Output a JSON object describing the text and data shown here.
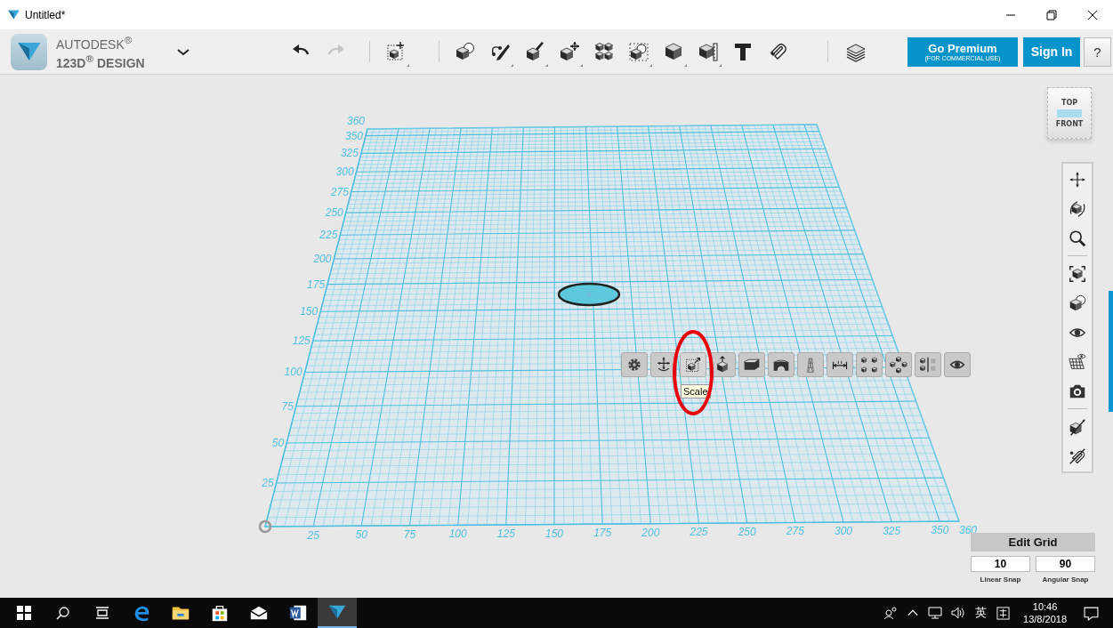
{
  "window": {
    "title": "Untitled*"
  },
  "brand": {
    "company": "AUTODESK$^{®}$",
    "product": "123D$^{®}$ DESIGN"
  },
  "history": [
    {
      "kind": "undo",
      "disabled": false
    },
    {
      "kind": "redo",
      "disabled": true
    }
  ],
  "tools": [
    {
      "kind": "transform"
    },
    {
      "kind": "primitives"
    },
    {
      "kind": "sketch"
    },
    {
      "kind": "construct"
    },
    {
      "kind": "modify"
    },
    {
      "kind": "pattern"
    },
    {
      "kind": "grouping"
    },
    {
      "kind": "combine"
    },
    {
      "kind": "measure"
    },
    {
      "kind": "text"
    },
    {
      "kind": "snap"
    },
    {
      "kind": "material"
    }
  ],
  "account": {
    "premium_title": "Go Premium",
    "premium_subtitle": "(FOR COMMERCIAL USE)",
    "sign_in": "Sign In",
    "help": "?"
  },
  "view_cube": {
    "top": "TOP",
    "front": "FRONT"
  },
  "grid": {
    "y_labels": [
      "360",
      "350",
      "325",
      "300",
      "275",
      "250",
      "225",
      "200",
      "175",
      "150",
      "125",
      "100",
      "75",
      "50",
      "25"
    ],
    "x_labels": [
      "25",
      "50",
      "75",
      "100",
      "125",
      "150",
      "175",
      "200",
      "225",
      "250",
      "275",
      "300",
      "325",
      "350",
      "360"
    ]
  },
  "object_toolbar": [
    {
      "kind": "settings"
    },
    {
      "kind": "move"
    },
    {
      "kind": "scale",
      "tooltip": "Scale"
    },
    {
      "kind": "extrude"
    },
    {
      "kind": "tweak"
    },
    {
      "kind": "shell"
    },
    {
      "kind": "loft"
    },
    {
      "kind": "dimension"
    },
    {
      "kind": "rect_pattern"
    },
    {
      "kind": "circ_pattern"
    },
    {
      "kind": "mirror"
    },
    {
      "kind": "hide"
    }
  ],
  "navigation": [
    {
      "kind": "pan"
    },
    {
      "kind": "orbit"
    },
    {
      "kind": "zoom"
    },
    {
      "kind": "separator"
    },
    {
      "kind": "fit"
    },
    {
      "kind": "shading"
    },
    {
      "kind": "visibility"
    },
    {
      "kind": "grid_view"
    },
    {
      "kind": "camera"
    },
    {
      "kind": "separator"
    },
    {
      "kind": "snap_off"
    },
    {
      "kind": "magnet_off"
    }
  ],
  "edit_grid": {
    "title": "Edit Grid",
    "linear_snap": "10",
    "linear_label": "Linear Snap",
    "angular_snap": "90",
    "angular_label": "Angular Snap"
  },
  "taskbar": {
    "apps": [
      {
        "kind": "edge",
        "selected": false
      },
      {
        "kind": "explorer",
        "selected": false
      },
      {
        "kind": "store",
        "selected": false
      },
      {
        "kind": "mail",
        "selected": false
      },
      {
        "kind": "word",
        "selected": false
      },
      {
        "kind": "design",
        "selected": true
      }
    ],
    "ime": "英",
    "time": "10:46",
    "date": "13/8/2018"
  }
}
